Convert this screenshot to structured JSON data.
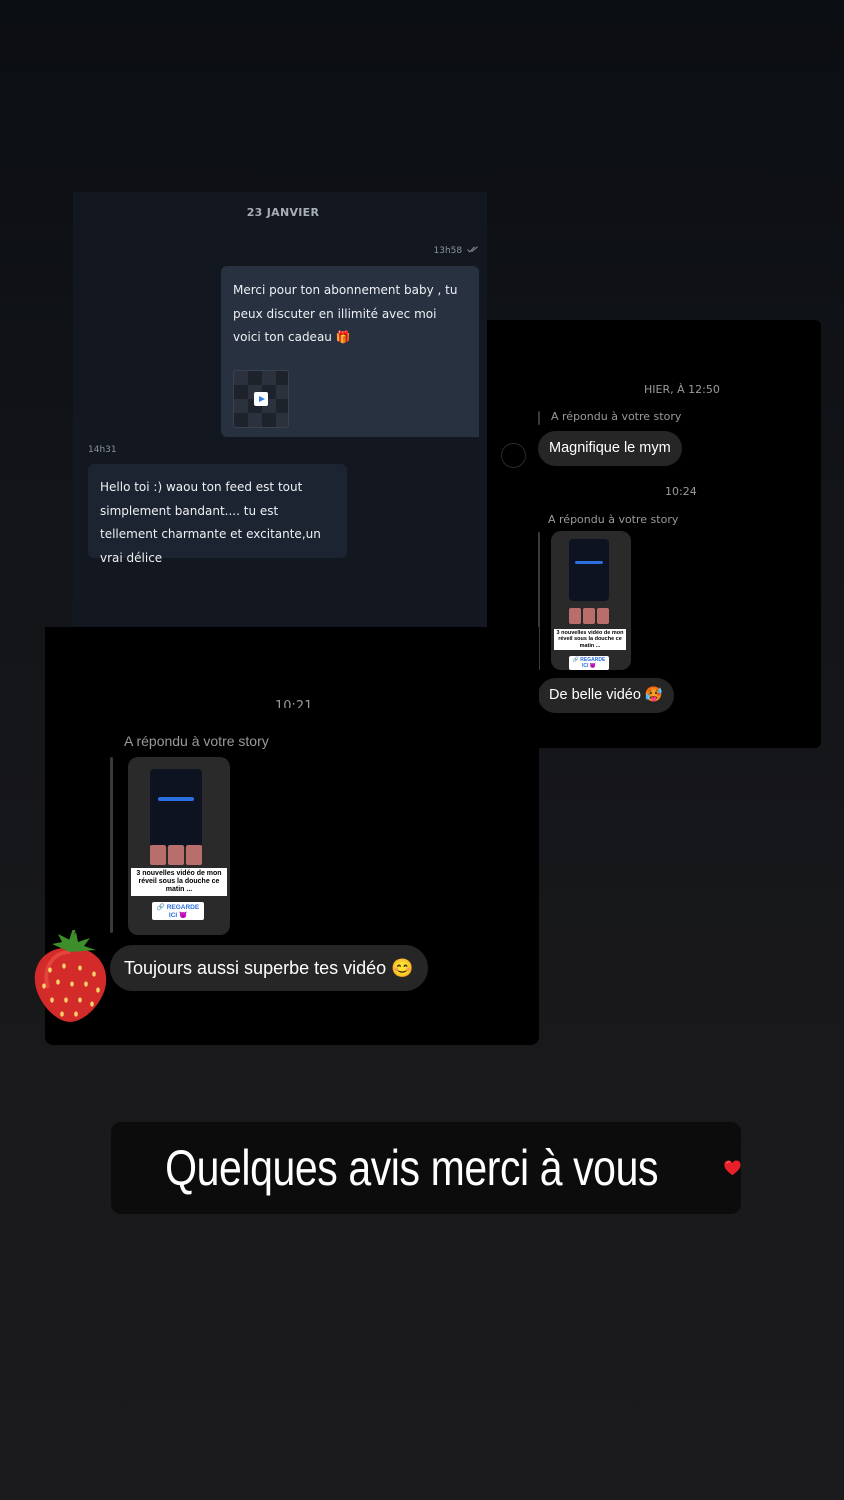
{
  "card1": {
    "date": "23 JANVIER",
    "out_time": "13h58",
    "out_message": "Merci pour ton abonnement baby , tu peux discuter en illimité avec moi voici ton cadeau 🎁",
    "in_time": "14h31",
    "in_message": "Hello toi :) waou ton feed est tout simplement bandant.... tu est tellement charmante et excitante,un vrai délice"
  },
  "card2": {
    "timestamp1": "HIER, À 12:50",
    "reply_label": "A répondu à votre story",
    "message1": "Magnifique le mym",
    "timestamp2": "10:24",
    "reply_label2": "A répondu à votre story",
    "message2": "De belle vidéo 🥵"
  },
  "story_thumb": {
    "caption": "3 nouvelles vidéo de mon réveil sous la douche ce matin ...",
    "link_label": "🔗 REGARDE ICI 😈"
  },
  "card3": {
    "cut_timestamp": "10:21",
    "reply_label": "A répondu à votre story",
    "message": "Toujours aussi superbe tes vidéo 😊"
  },
  "banner": {
    "text": "Quelques avis merci à vous"
  },
  "colors": {
    "accent_blue": "#2c6ee0",
    "bubble_out": "#283140",
    "bubble_in": "#1d2431",
    "ig_bubble": "#262626"
  },
  "icons": [
    "read-checkmarks-icon",
    "play-video-icon",
    "strawberry-icon",
    "heart-icon"
  ]
}
